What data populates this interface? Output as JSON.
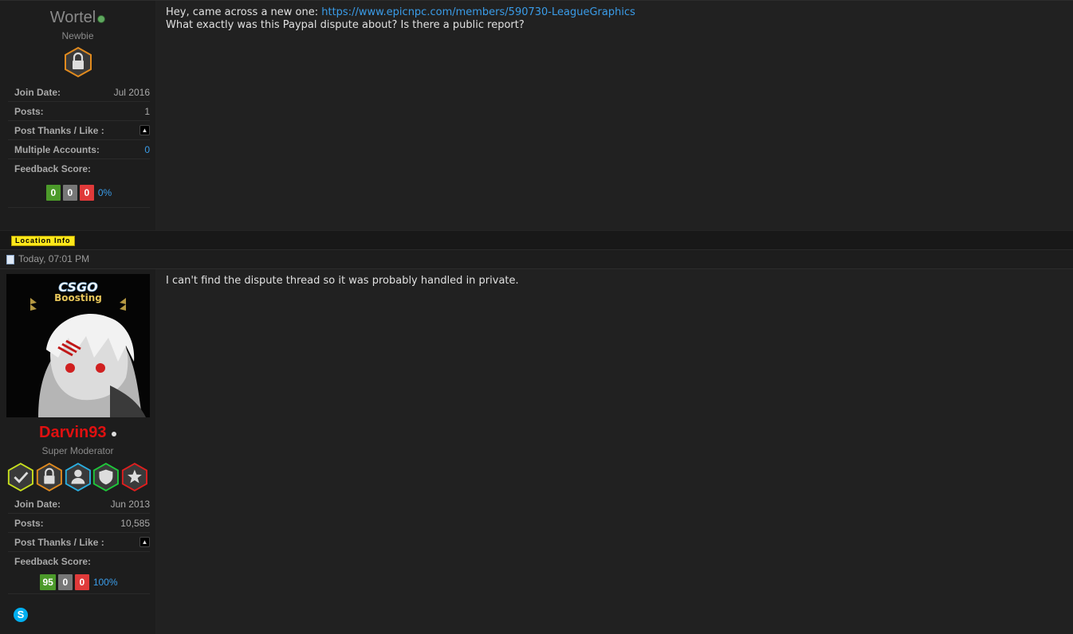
{
  "posts": [
    {
      "user": {
        "name": "Wortel",
        "rank": "Newbie",
        "online_color": "#5fa85f",
        "badges": [
          "lock-badge"
        ],
        "stats": {
          "join_date_label": "Join Date:",
          "join_date": "Jul 2016",
          "posts_label": "Posts:",
          "posts": "1",
          "thanks_label": "Post Thanks / Like :",
          "multi_label": "Multiple Accounts:",
          "multi": "0",
          "feedback_label": "Feedback Score:"
        },
        "feedback": {
          "positive": "0",
          "neutral": "0",
          "negative": "0",
          "percent": "0%"
        }
      },
      "content": {
        "line1_prefix": "Hey, came across a new one: ",
        "link": "https://www.epicnpc.com/members/590730-LeagueGraphics",
        "line2": "What exactly was this Paypal dispute about? Is there a public report?"
      }
    },
    {
      "date": "Today, 07:01 PM",
      "user": {
        "name": "Darvin93",
        "rank": "Super Moderator",
        "online_color": "#dddddd",
        "avatar_text_1": "CSGO",
        "avatar_text_2": "Boosting",
        "badges": [
          "check-badge",
          "lock-badge",
          "user-badge",
          "shield-badge",
          "star-badge"
        ],
        "stats": {
          "join_date_label": "Join Date:",
          "join_date": "Jun 2013",
          "posts_label": "Posts:",
          "posts": "10,585",
          "thanks_label": "Post Thanks / Like :",
          "feedback_label": "Feedback Score:"
        },
        "feedback": {
          "positive": "95",
          "neutral": "0",
          "negative": "0",
          "percent": "100%"
        },
        "contact_icon": "skype-icon"
      },
      "content": {
        "text": "I can't find the dispute thread so it was probably handled in private."
      }
    }
  ],
  "location_button": "Location Info"
}
